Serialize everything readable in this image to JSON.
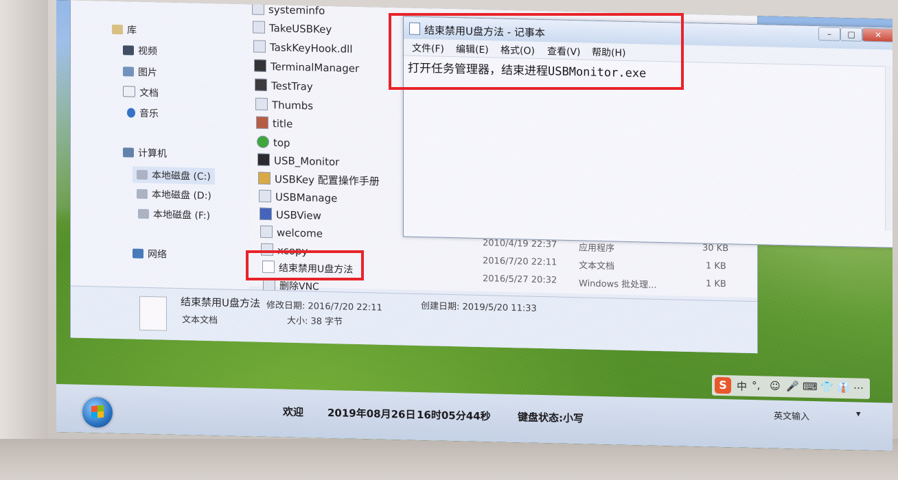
{
  "nav_pane": {
    "items": [
      {
        "label": "库",
        "icon": "library-icon"
      },
      {
        "label": "视频",
        "icon": "video-icon"
      },
      {
        "label": "图片",
        "icon": "picture-icon"
      },
      {
        "label": "文档",
        "icon": "document-icon"
      },
      {
        "label": "音乐",
        "icon": "music-icon"
      },
      {
        "label": "计算机",
        "icon": "computer-icon"
      },
      {
        "label": "本地磁盘 (C:)",
        "icon": "drive-icon"
      },
      {
        "label": "本地磁盘 (D:)",
        "icon": "drive-icon"
      },
      {
        "label": "本地磁盘 (F:)",
        "icon": "drive-icon"
      },
      {
        "label": "网络",
        "icon": "network-icon"
      }
    ]
  },
  "file_list": {
    "items": [
      "systeminfo",
      "TakeUSBKey",
      "TaskKeyHook.dll",
      "TerminalManager",
      "TestTray",
      "Thumbs",
      "title",
      "top",
      "USB_Monitor",
      "USBKey 配置操作手册",
      "USBManage",
      "USBView",
      "welcome",
      "xcopy",
      "结束禁用U盘方法",
      "删除VNC"
    ],
    "details_rows": [
      {
        "date": "2010/4/19 22:37",
        "type": "应用程序",
        "size": "30 KB"
      },
      {
        "date": "2016/7/20 22:11",
        "type": "文本文档",
        "size": "1 KB"
      },
      {
        "date": "2016/5/27 20:32",
        "type": "Windows 批处理...",
        "size": "1 KB"
      }
    ]
  },
  "details_pane": {
    "name": "结束禁用U盘方法",
    "modified": "修改日期: 2016/7/20 22:11",
    "created": "创建日期: 2019/5/20 11:33",
    "type": "文本文档",
    "size": "大小: 38 字节"
  },
  "notepad": {
    "title": "结束禁用U盘方法 - 记事本",
    "menus": [
      "文件(F)",
      "编辑(E)",
      "格式(O)",
      "查看(V)",
      "帮助(H)"
    ],
    "content": "打开任务管理器，结束进程USBMonitor.exe"
  },
  "ime": {
    "logo": "S",
    "items": [
      "中",
      "°,",
      "☺",
      "🎤",
      "⌨",
      "👕",
      "👔",
      "⋯"
    ]
  },
  "taskbar": {
    "welcome": "欢迎",
    "date": "2019年08月26日",
    "time": "16时05分44秒",
    "keyboard_state": "键盘状态:小写",
    "input_lang": "英文输入"
  },
  "colors": {
    "highlight": "#e8232a",
    "taskbar": "#c9d8ea"
  }
}
